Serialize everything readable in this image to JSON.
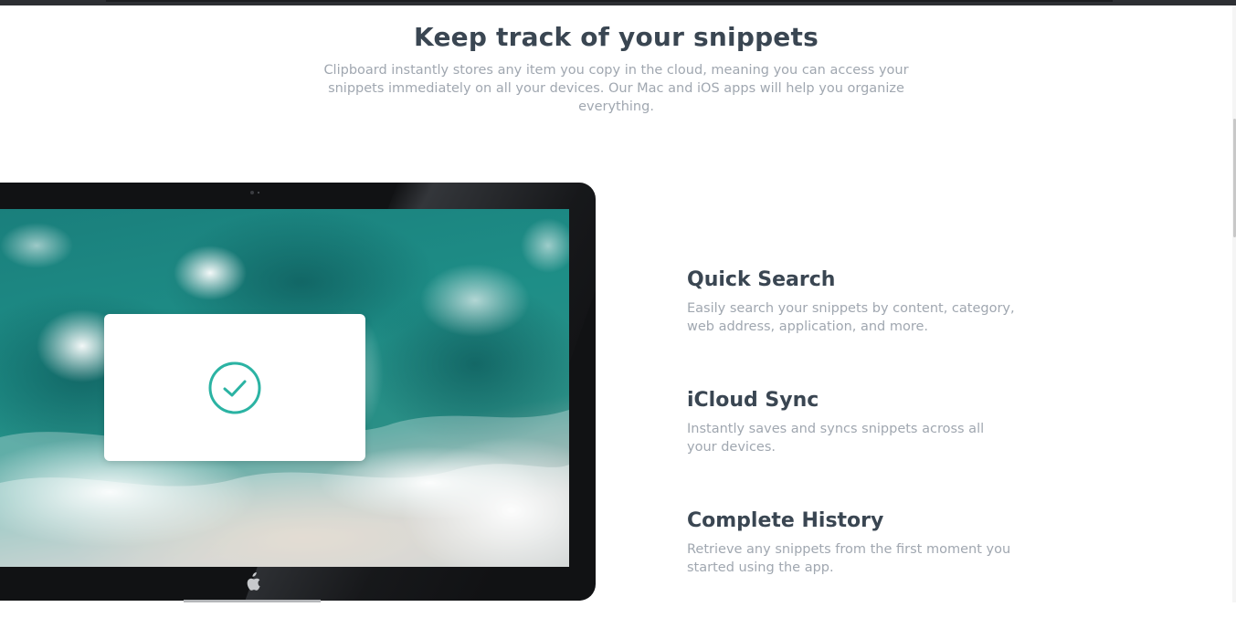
{
  "intro": {
    "title": "Keep track of your snippets",
    "description": "Clipboard instantly stores any item you copy in the cloud, meaning you can access your snippets immediately on all your devices. Our Mac and iOS apps will help you organize everything."
  },
  "mockup": {
    "status_icon": "checkmark-circle-icon",
    "brand_icon": "apple-logo-icon",
    "accent_color": "#2bb3a3"
  },
  "features": [
    {
      "title": "Quick Search",
      "description": "Easily search your snippets by content, category, web address, application, and more."
    },
    {
      "title": "iCloud Sync",
      "description": "Instantly saves and syncs snippets across all your devices."
    },
    {
      "title": "Complete History",
      "description": "Retrieve any snippets from the first moment you started using the app."
    }
  ]
}
